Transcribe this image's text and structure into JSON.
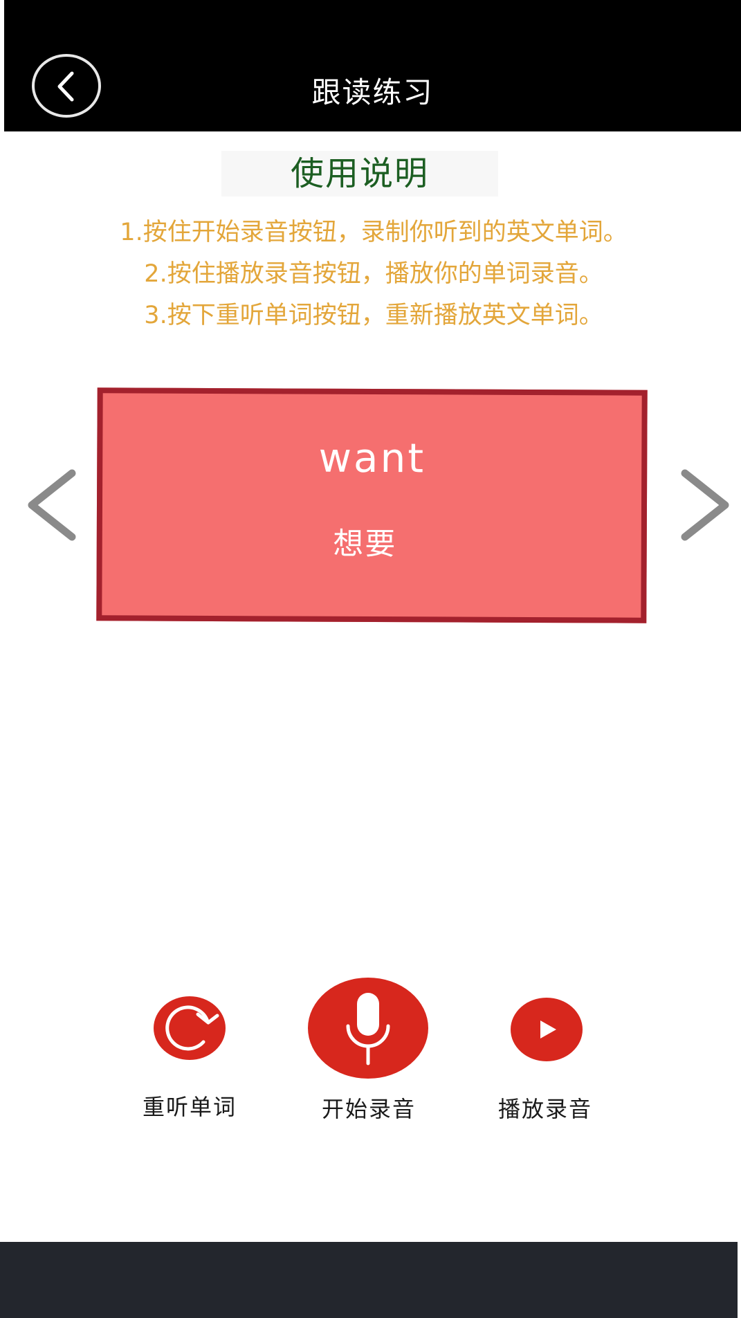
{
  "header": {
    "title": "跟读练习"
  },
  "instructions": {
    "title": "使用说明",
    "lines": [
      "1.按住开始录音按钮，录制你听到的英文单词。",
      "2.按住播放录音按钮，播放你的单词录音。",
      "3.按下重听单词按钮，重新播放英文单词。"
    ]
  },
  "card": {
    "word": "want",
    "meaning": "想要"
  },
  "actions": {
    "replay_label": "重听单词",
    "record_label": "开始录音",
    "play_label": "播放录音"
  },
  "icons": {
    "back": "back-circle-icon",
    "prev": "chevron-left-icon",
    "next": "chevron-right-icon",
    "replay": "replay-icon",
    "record": "microphone-icon",
    "play": "play-icon"
  },
  "colors": {
    "header_bg": "#000000",
    "instruction_title": "#1c5e22",
    "instruction_text": "#e3a63a",
    "card_bg": "#f56f6f",
    "card_border": "#a3212d",
    "button_red": "#d7271d",
    "footer_bg": "#23262d"
  }
}
